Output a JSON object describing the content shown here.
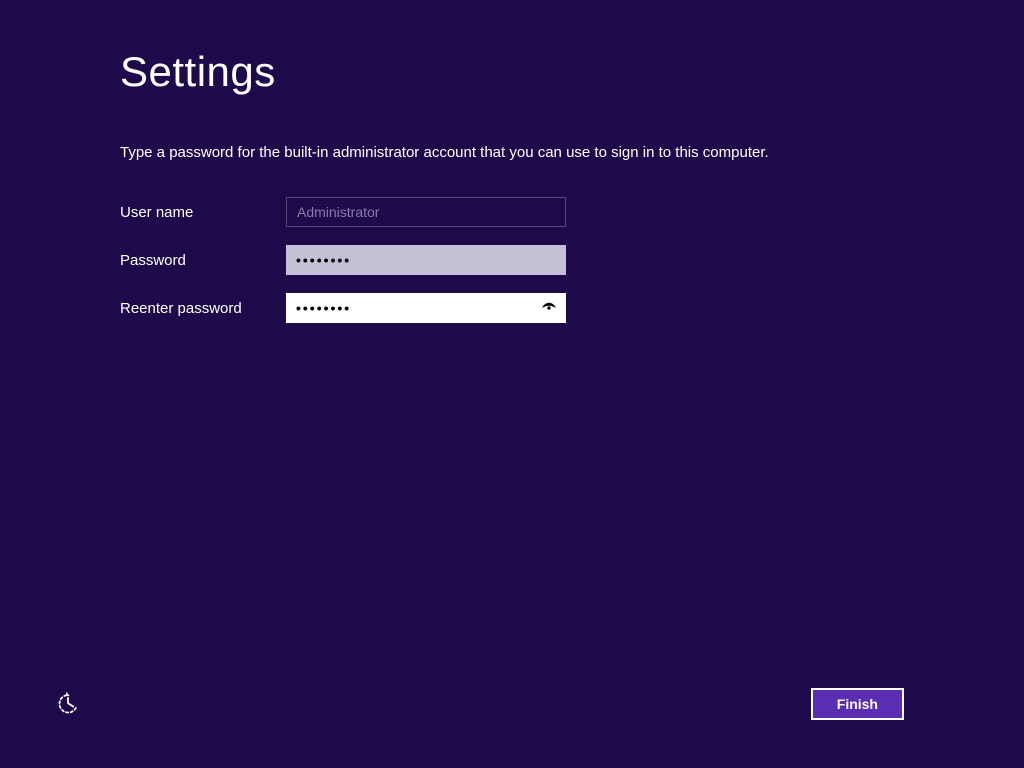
{
  "header": {
    "title": "Settings"
  },
  "instruction": "Type a password for the built-in administrator account that you can use to sign in to this computer.",
  "form": {
    "username_label": "User name",
    "username_value": "Administrator",
    "password_label": "Password",
    "password_value": "••••••••",
    "reenter_label": "Reenter password",
    "reenter_value": "••••••••"
  },
  "footer": {
    "finish_label": "Finish"
  }
}
